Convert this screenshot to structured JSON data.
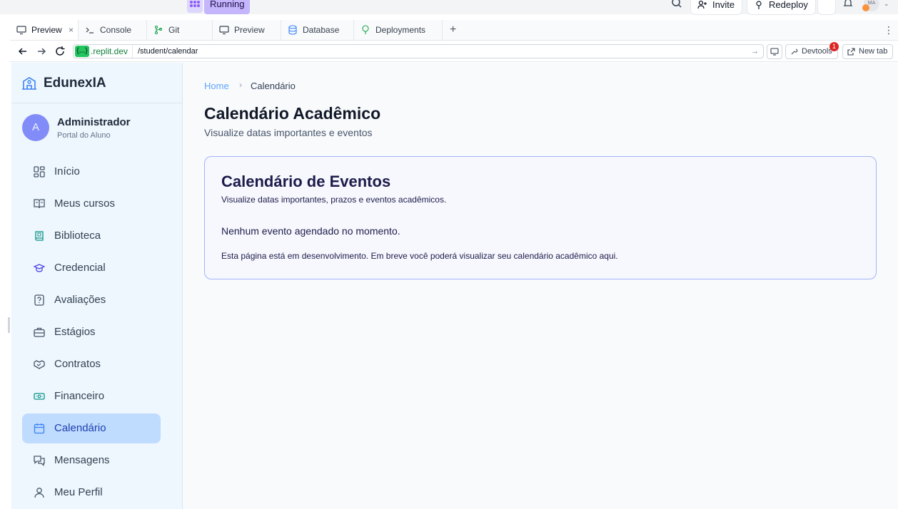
{
  "replit": {
    "status": "Running",
    "invite_label": "Invite",
    "redeploy_label": "Redeploy",
    "avatar_initials": "MA",
    "tabs": [
      {
        "label": "Preview",
        "icon": "monitor-icon",
        "active": true
      },
      {
        "label": "Console",
        "icon": "terminal-icon"
      },
      {
        "label": "Git",
        "icon": "git-icon"
      },
      {
        "label": "Preview",
        "icon": "monitor-icon"
      },
      {
        "label": "Database",
        "icon": "database-icon"
      },
      {
        "label": "Deployments",
        "icon": "deployments-icon"
      }
    ],
    "tab_close": "×",
    "add_tab": "+",
    "more": "⋮",
    "address": {
      "badge": "{...}",
      "domain": ".replit.dev",
      "path": "/student/calendar",
      "go": "→"
    },
    "devtools_label": "Devtools",
    "devtools_badge": "1",
    "new_tab_label": "New tab"
  },
  "app": {
    "brand": "EdunexIA",
    "user": {
      "initial": "A",
      "name": "Administrador",
      "role": "Portal do Aluno"
    },
    "nav": [
      {
        "label": "Início",
        "icon": "dashboard-icon"
      },
      {
        "label": "Meus cursos",
        "icon": "book-open-icon"
      },
      {
        "label": "Biblioteca",
        "icon": "library-icon"
      },
      {
        "label": "Credencial",
        "icon": "graduation-cap-icon"
      },
      {
        "label": "Avaliações",
        "icon": "question-file-icon"
      },
      {
        "label": "Estágios",
        "icon": "briefcase-icon"
      },
      {
        "label": "Contratos",
        "icon": "handshake-icon"
      },
      {
        "label": "Financeiro",
        "icon": "banknote-icon"
      },
      {
        "label": "Calendário",
        "icon": "calendar-icon",
        "active": true
      },
      {
        "label": "Mensagens",
        "icon": "messages-icon"
      },
      {
        "label": "Meu Perfil",
        "icon": "user-icon"
      }
    ],
    "breadcrumb": {
      "home": "Home",
      "current": "Calendário"
    },
    "page_title": "Calendário Acadêmico",
    "page_subtitle": "Visualize datas importantes e eventos",
    "card": {
      "title": "Calendário de Eventos",
      "subtitle": "Visualize datas importantes, prazos e eventos acadêmicos.",
      "empty": "Nenhum evento agendado no momento.",
      "note": "Esta página está em desenvolvimento. Em breve você poderá visualizar seu calendário acadêmico aqui."
    },
    "colors": {
      "accent": "#bfdbfe",
      "sidebar_bg": "#eef7fd",
      "card_border": "#a5b4fc",
      "avatar": "#818cf8"
    }
  }
}
